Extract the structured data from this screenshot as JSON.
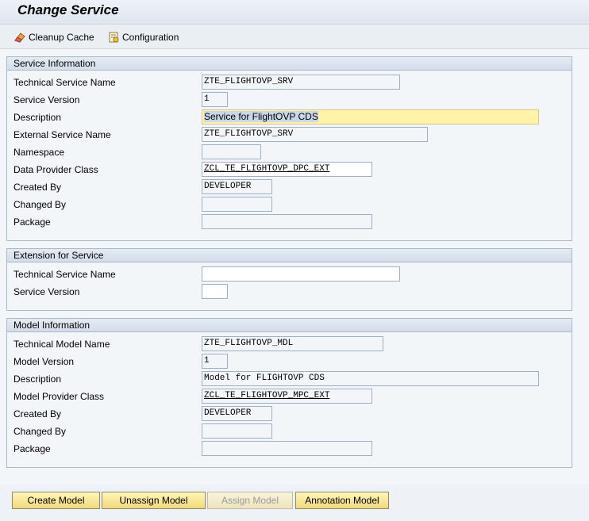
{
  "header": {
    "title": "Change Service"
  },
  "toolbar": {
    "cleanup_label": "Cleanup Cache",
    "config_label": "Configuration"
  },
  "service_info": {
    "heading": "Service Information",
    "rows": [
      {
        "label": "Technical Service Name",
        "value": "ZTE_FLIGHTOVP_SRV"
      },
      {
        "label": "Service Version",
        "value": "1"
      },
      {
        "label": "Description",
        "value": "Service for FlightOVP CDS"
      },
      {
        "label": "External Service Name",
        "value": "ZTE_FLIGHTOVP_SRV"
      },
      {
        "label": "Namespace",
        "value": ""
      },
      {
        "label": "Data Provider Class",
        "value": "ZCL_TE_FLIGHTOVP_DPC_EXT"
      },
      {
        "label": "Created By",
        "value": "DEVELOPER"
      },
      {
        "label": "Changed By",
        "value": ""
      },
      {
        "label": "Package",
        "value": ""
      }
    ]
  },
  "extension": {
    "heading": "Extension for Service",
    "rows": [
      {
        "label": "Technical Service Name",
        "value": ""
      },
      {
        "label": "Service Version",
        "value": ""
      }
    ]
  },
  "model_info": {
    "heading": "Model Information",
    "rows": [
      {
        "label": "Technical Model Name",
        "value": "ZTE_FLIGHTOVP_MDL"
      },
      {
        "label": "Model Version",
        "value": "1"
      },
      {
        "label": "Description",
        "value": "Model for FLIGHTOVP CDS"
      },
      {
        "label": "Model Provider Class",
        "value": "ZCL_TE_FLIGHTOVP_MPC_EXT"
      },
      {
        "label": "Created By",
        "value": "DEVELOPER"
      },
      {
        "label": "Changed By",
        "value": ""
      },
      {
        "label": "Package",
        "value": ""
      }
    ]
  },
  "buttons": {
    "create_model": "Create Model",
    "unassign_model": "Unassign Model",
    "assign_model": "Assign Model",
    "annotation_model": "Annotation Model"
  },
  "colors": {
    "button_yellow": "#f2d97a",
    "highlight_field": "#fff3a8",
    "group_border": "#a9b9cc"
  },
  "icons": {
    "cleanup": "eraser-icon",
    "configuration": "config-icon"
  }
}
